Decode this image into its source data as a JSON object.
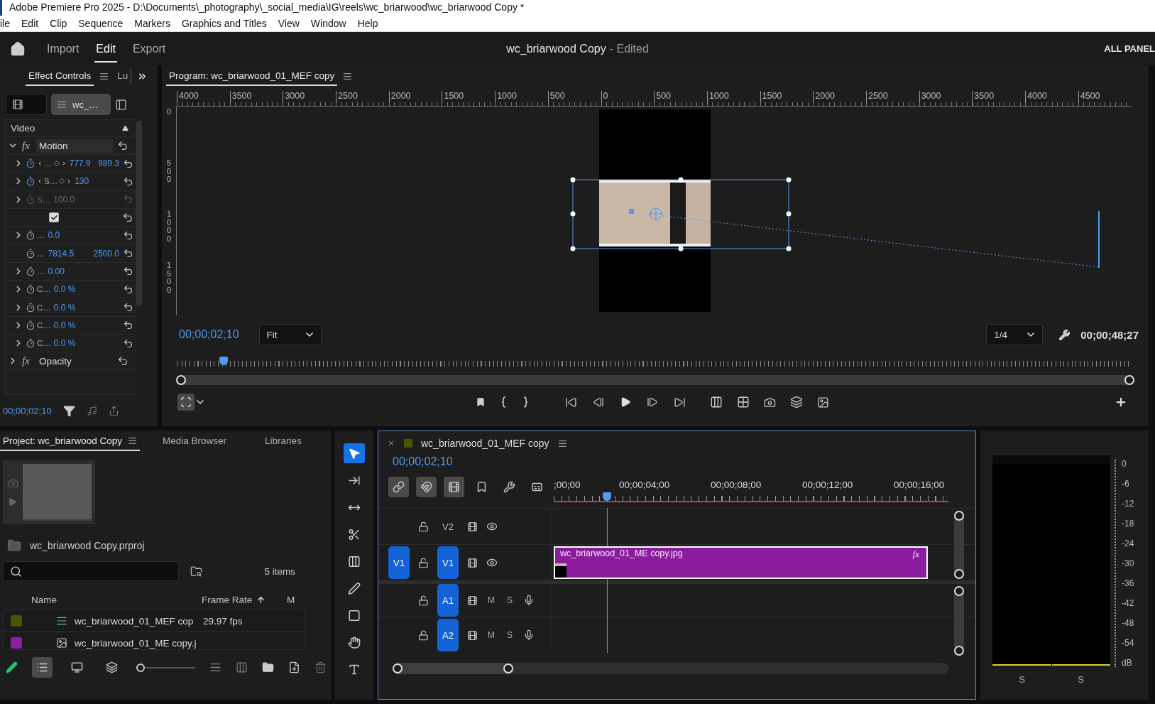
{
  "window": {
    "title": "Adobe Premiere Pro 2025 - D:\\Documents\\_photography\\_social_media\\IG\\reels\\wc_briarwood\\wc_briarwood Copy *"
  },
  "menu": [
    "ile",
    "Edit",
    "Clip",
    "Sequence",
    "Markers",
    "Graphics and Titles",
    "View",
    "Window",
    "Help"
  ],
  "header": {
    "tabs": [
      {
        "label": "Import",
        "selected": false
      },
      {
        "label": "Edit",
        "selected": true
      },
      {
        "label": "Export",
        "selected": false
      }
    ],
    "document": "wc_briarwood Copy",
    "document_status": "- Edited",
    "workspace": "ALL PANEL"
  },
  "effect_controls": {
    "tabs": [
      {
        "label": "Effect Controls",
        "selected": true
      },
      {
        "label": "Lu",
        "selected": false
      }
    ],
    "clip": "wc_…",
    "section": "Video",
    "effects": [
      {
        "icon_text": "fx",
        "name": "Motion",
        "expanded": true,
        "params": [
          {
            "kind": "value",
            "expandable": true,
            "animated": true,
            "disabled": false,
            "label": "…",
            "value": "777.9",
            "value2": "989.3"
          },
          {
            "kind": "value",
            "expandable": true,
            "animated": true,
            "disabled": false,
            "label": "S…",
            "value": "130"
          },
          {
            "kind": "value",
            "expandable": true,
            "animated": false,
            "disabled": true,
            "label": "S…",
            "value": "100.0"
          },
          {
            "kind": "checkbox",
            "checked": true
          },
          {
            "kind": "value",
            "expandable": true,
            "animated": false,
            "disabled": false,
            "label": "…",
            "value": "0.0"
          },
          {
            "kind": "value",
            "expandable": false,
            "animated": false,
            "disabled": false,
            "label": "…",
            "value": "7814.5",
            "value2": "2500.0"
          },
          {
            "kind": "value",
            "expandable": true,
            "animated": false,
            "disabled": false,
            "label": "…",
            "value": "0.00"
          },
          {
            "kind": "value",
            "expandable": true,
            "animated": false,
            "disabled": false,
            "label": "C…",
            "value": "0.0 %"
          },
          {
            "kind": "value",
            "expandable": true,
            "animated": false,
            "disabled": false,
            "label": "C…",
            "value": "0.0 %"
          },
          {
            "kind": "value",
            "expandable": true,
            "animated": false,
            "disabled": false,
            "label": "C…",
            "value": "0.0 %"
          },
          {
            "kind": "value",
            "expandable": true,
            "animated": false,
            "disabled": false,
            "label": "C…",
            "value": "0.0 %"
          }
        ]
      },
      {
        "icon_text": "fx",
        "name": "Opacity",
        "expanded": false
      }
    ],
    "timecode": "00;00;02;10"
  },
  "program": {
    "tab": "Program: wc_briarwood_01_MEF copy",
    "ruler_h": [
      "4000",
      "3500",
      "3000",
      "2500",
      "2000",
      "1500",
      "1000",
      "500",
      "0",
      "500",
      "1000",
      "1500",
      "2000",
      "2500",
      "3000",
      "3500",
      "4000",
      "4500"
    ],
    "ruler_v": [
      "0",
      "500",
      "1000",
      "1500"
    ],
    "timecode": "00;00;02;10",
    "fit": "Fit",
    "resolution": "1/4",
    "duration": "00;00;48;27",
    "playhead": {
      "level": 0.048
    }
  },
  "project": {
    "tabs": [
      {
        "label": "Project: wc_briarwood Copy",
        "selected": true
      },
      {
        "label": "Media Browser",
        "selected": false
      },
      {
        "label": "Libraries",
        "selected": false
      }
    ],
    "file": "wc_briarwood Copy.prproj",
    "count": "5 items",
    "columns": [
      "Name",
      "Frame Rate",
      "M"
    ],
    "items": [
      {
        "kind": "sequence",
        "color": "#4d5200",
        "name": "wc_briarwood_01_MEF cop",
        "frame_rate": "29.97 fps"
      },
      {
        "kind": "image",
        "color": "#8e1ea6",
        "name": "wc_briarwood_01_ME copy.j"
      }
    ],
    "views": [
      {
        "kind": "list",
        "selected": true
      },
      {
        "kind": "icon",
        "selected": false
      },
      {
        "kind": "freeform",
        "selected": false
      }
    ],
    "zoom": {
      "level": 0
    }
  },
  "tools": [
    {
      "kind": "selection",
      "selected": true
    },
    {
      "kind": "track_select",
      "selected": false
    },
    {
      "kind": "ripple",
      "selected": false
    },
    {
      "kind": "razor",
      "selected": false
    },
    {
      "kind": "slip",
      "selected": false
    },
    {
      "kind": "pen",
      "selected": false
    },
    {
      "kind": "rectangle",
      "selected": false
    },
    {
      "kind": "hand",
      "selected": false
    },
    {
      "kind": "type",
      "selected": false
    }
  ],
  "timeline": {
    "title": "wc_briarwood_01_MEF copy",
    "timecode": "00;00;02;10",
    "toggles": [
      {
        "kind": "insert",
        "on": true
      },
      {
        "kind": "snap",
        "on": true
      },
      {
        "kind": "linked",
        "on": true
      },
      {
        "kind": "marker",
        "on": false
      },
      {
        "kind": "settings",
        "on": false
      },
      {
        "kind": "captions",
        "on": false
      }
    ],
    "ruler": [
      ";00;00",
      "00;00;04;00",
      "00;00;08;00",
      "00;00;12;00",
      "00;00;16;00"
    ],
    "playhead": {
      "level": 0.135
    },
    "tracks": [
      {
        "kind": "video",
        "label": "V2",
        "targeted": false
      },
      {
        "kind": "video",
        "label": "V1",
        "source": "V1",
        "targeted": true,
        "clip": {
          "name": "wc_briarwood_01_ME copy.jpg",
          "fx": "fx"
        }
      },
      {
        "kind": "audio",
        "label": "A1",
        "targeted": true,
        "mute": "M",
        "solo": "S"
      },
      {
        "kind": "audio",
        "label": "A2",
        "targeted": true,
        "mute": "M",
        "solo": "S"
      }
    ]
  },
  "meter": {
    "scale": [
      "0",
      "-6",
      "-12",
      "-18",
      "-24",
      "-30",
      "-36",
      "-42",
      "-48",
      "-54",
      "dB"
    ],
    "channels": [
      "S",
      "S"
    ]
  }
}
